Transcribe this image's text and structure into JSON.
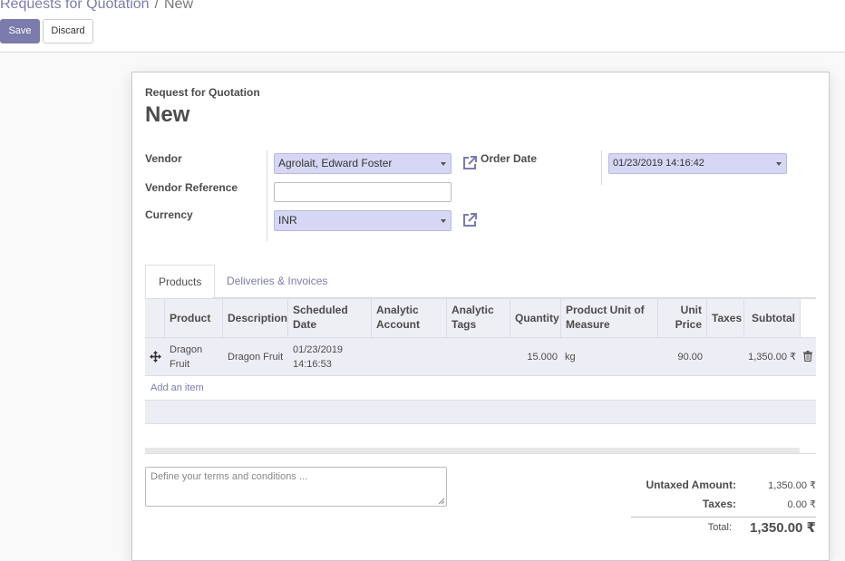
{
  "breadcrumb": {
    "parent": "Requests for Quotation",
    "separator": "/",
    "current": "New"
  },
  "toolbar": {
    "save_label": "Save",
    "discard_label": "Discard"
  },
  "form": {
    "doc_type": "Request for Quotation",
    "doc_name": "New",
    "vendor_label": "Vendor",
    "vendor_value": "Agrolait, Edward Foster",
    "vendor_ref_label": "Vendor Reference",
    "vendor_ref_value": "",
    "currency_label": "Currency",
    "currency_value": "INR",
    "order_date_label": "Order Date",
    "order_date_value": "01/23/2019 14:16:42"
  },
  "tabs": [
    {
      "label": "Products",
      "active": true
    },
    {
      "label": "Deliveries & Invoices",
      "active": false
    }
  ],
  "table": {
    "headers": {
      "product": "Product",
      "description": "Description",
      "scheduled_line1": "Scheduled",
      "scheduled_line2": "Date",
      "analytic_account_line1": "Analytic",
      "analytic_account_line2": "Account",
      "analytic_tags_line1": "Analytic",
      "analytic_tags_line2": "Tags",
      "quantity": "Quantity",
      "uom_line1": "Product Unit of",
      "uom_line2": "Measure",
      "unit_price_line1": "Unit",
      "unit_price_line2": "Price",
      "taxes": "Taxes",
      "subtotal": "Subtotal"
    },
    "rows": [
      {
        "product_line1": "Dragon",
        "product_line2": "Fruit",
        "description": "Dragon Fruit",
        "date_line1": "01/23/2019",
        "date_line2": "14:16:53",
        "analytic_account": "",
        "analytic_tags": "",
        "quantity": "15.000",
        "uom": "kg",
        "unit_price": "90.00",
        "taxes": "",
        "subtotal": "1,350.00 ₹"
      }
    ],
    "add_item_label": "Add an item"
  },
  "notes": {
    "placeholder": "Define your terms and conditions ..."
  },
  "totals": {
    "untaxed_label": "Untaxed Amount:",
    "untaxed_value": "1,350.00 ₹",
    "taxes_label": "Taxes:",
    "taxes_value": "0.00 ₹",
    "total_label": "Total:",
    "total_value": "1,350.00 ₹"
  },
  "icons": {
    "drag_handle": "move-icon",
    "delete_row": "trash-icon",
    "external_link": "external-link-icon"
  },
  "colors": {
    "primary": "#7c7bad",
    "field_highlight": "#d6d6f5",
    "row_background": "#ededf5"
  }
}
